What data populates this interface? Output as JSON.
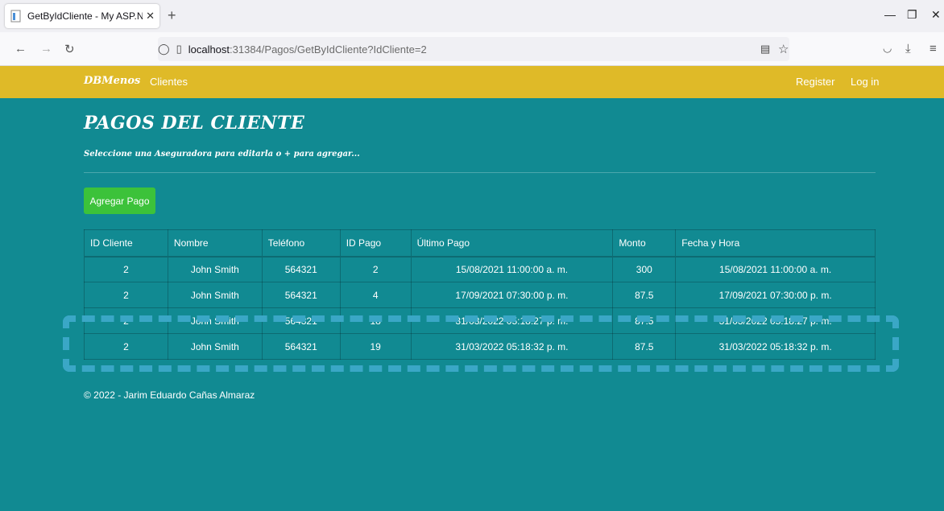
{
  "browser": {
    "tab_title": "GetByIdCliente - My ASP.NET A",
    "url_host": "localhost",
    "url_rest": ":31384/Pagos/GetByIdCliente?IdCliente=2"
  },
  "app": {
    "brand": "DBMenos",
    "nav_clientes": "Clientes",
    "register": "Register",
    "login": "Log in"
  },
  "content": {
    "title": "PAGOS DEL CLIENTE",
    "subtitle": "Seleccione una Aseguradora para editarla o + para agregar...",
    "add_button": "Agregar Pago"
  },
  "table": {
    "headers": [
      "ID Cliente",
      "Nombre",
      "Teléfono",
      "ID Pago",
      "Último Pago",
      "Monto",
      "Fecha y Hora"
    ],
    "rows": [
      [
        "2",
        "John Smith",
        "564321",
        "2",
        "15/08/2021 11:00:00 a. m.",
        "300",
        "15/08/2021 11:00:00 a. m."
      ],
      [
        "2",
        "John Smith",
        "564321",
        "4",
        "17/09/2021 07:30:00 p. m.",
        "87.5",
        "17/09/2021 07:30:00 p. m."
      ],
      [
        "2",
        "John Smith",
        "564321",
        "18",
        "31/03/2022 05:18:27 p. m.",
        "87.5",
        "31/03/2022 05:18:27 p. m."
      ],
      [
        "2",
        "John Smith",
        "564321",
        "19",
        "31/03/2022 05:18:32 p. m.",
        "87.5",
        "31/03/2022 05:18:32 p. m."
      ]
    ]
  },
  "footer": "© 2022 - Jarim Eduardo Cañas Almaraz",
  "colors": {
    "page_bg": "#118a92",
    "navbar": "#dfba28",
    "add_button": "#3cc23a",
    "overlay": "#3aa7c6"
  }
}
